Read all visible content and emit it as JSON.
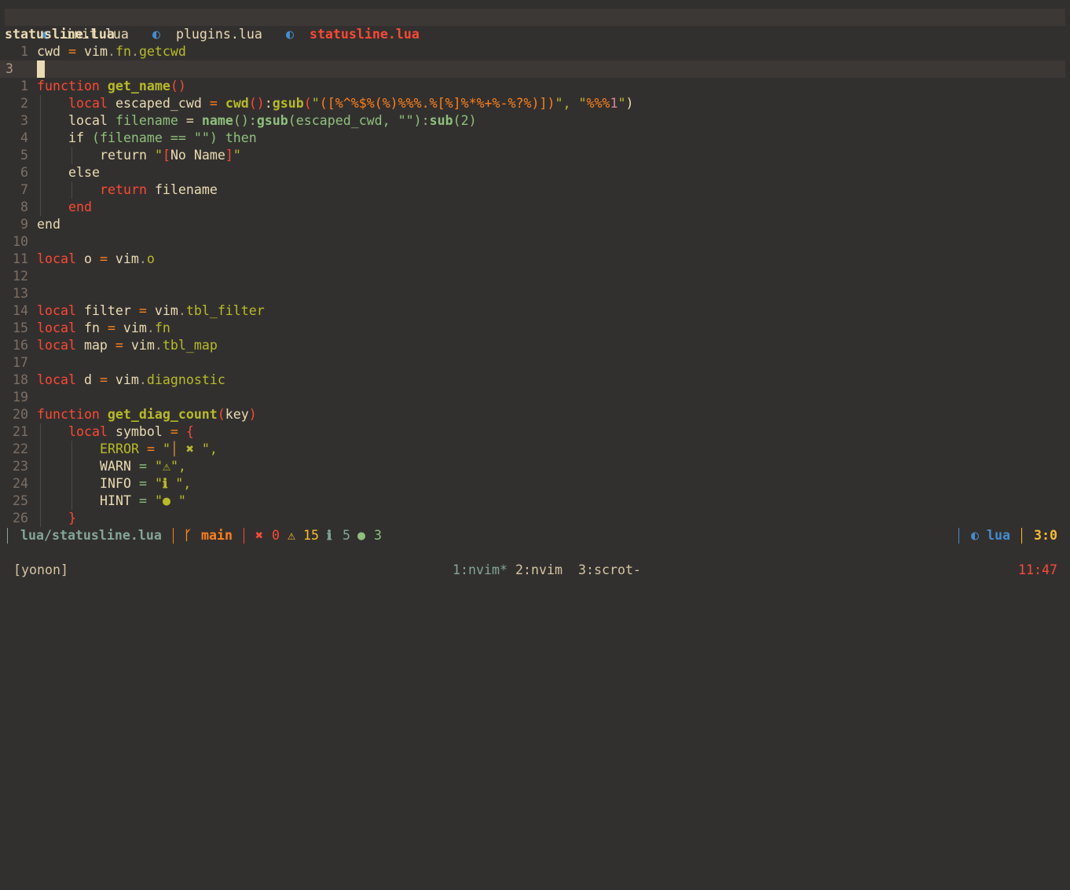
{
  "tabline": {
    "tabs": [
      {
        "icon": "lua-icon",
        "glyph": "◐",
        "label": "init.lua",
        "active": false
      },
      {
        "icon": "lua-icon",
        "glyph": "◐",
        "label": "plugins.lua",
        "active": false
      },
      {
        "icon": "lua-icon",
        "glyph": "◐",
        "label": "statusline.lua",
        "active": true
      }
    ]
  },
  "winbar": {
    "title": "statusline.lua"
  },
  "editor": {
    "lines": [
      {
        "nr": "1",
        "tokens": [
          [
            "fg",
            "cwd"
          ],
          [
            "op",
            " = "
          ],
          [
            "fg",
            "vim"
          ],
          [
            "dim",
            "."
          ],
          [
            "fld",
            "fn"
          ],
          [
            "dim",
            "."
          ],
          [
            "fld",
            "getcwd"
          ]
        ]
      },
      {
        "nr": "3",
        "current": true,
        "tokens": []
      },
      {
        "nr": "1",
        "tokens": [
          [
            "kw",
            "function "
          ],
          [
            "fn",
            "get_name"
          ],
          [
            "pu",
            "()"
          ]
        ]
      },
      {
        "nr": "2",
        "indent": 1,
        "tokens": [
          [
            "kw",
            "local "
          ],
          [
            "fg",
            "escaped_cwd "
          ],
          [
            "op",
            "= "
          ],
          [
            "fn",
            "cwd"
          ],
          [
            "pu",
            "()"
          ],
          [
            "fg",
            ":"
          ],
          [
            "fn",
            "gsub"
          ],
          [
            "pu",
            "("
          ],
          [
            "strg",
            "\""
          ],
          [
            "esc",
            "([%^%$%(%)%%%.%[%]%*%+%-%?%)])"
          ],
          [
            "strg",
            "\", \""
          ],
          [
            "esc",
            "%%%"
          ],
          [
            "num",
            "1"
          ],
          [
            "strg",
            "\""
          ],
          [
            "fg",
            ")"
          ]
        ]
      },
      {
        "nr": "3",
        "indent": 1,
        "tokens": [
          [
            "fg",
            "local "
          ],
          [
            "aq",
            "filename "
          ],
          [
            "fg",
            "= "
          ],
          [
            "aqb",
            "name"
          ],
          [
            "aq",
            "():"
          ],
          [
            "aqb",
            "gsub"
          ],
          [
            "aq",
            "(escaped_cwd, \"\"):"
          ],
          [
            "aqb",
            "sub"
          ],
          [
            "aq",
            "(2)"
          ]
        ]
      },
      {
        "nr": "4",
        "indent": 1,
        "tokens": [
          [
            "fg",
            "if "
          ],
          [
            "aq",
            "(filename == \"\") then"
          ]
        ]
      },
      {
        "nr": "5",
        "indent": 2,
        "tokens": [
          [
            "fg",
            "return "
          ],
          [
            "strg",
            "\""
          ],
          [
            "brk",
            "["
          ],
          [
            "fg",
            "No Name"
          ],
          [
            "brk",
            "]"
          ],
          [
            "strg",
            "\""
          ]
        ]
      },
      {
        "nr": "6",
        "indent": 1,
        "tokens": [
          [
            "fg",
            "else"
          ]
        ]
      },
      {
        "nr": "7",
        "indent": 2,
        "tokens": [
          [
            "kw",
            "return "
          ],
          [
            "fg",
            "filename"
          ]
        ]
      },
      {
        "nr": "8",
        "indent": 1,
        "tokens": [
          [
            "kw",
            "end"
          ]
        ]
      },
      {
        "nr": "9",
        "tokens": [
          [
            "fg",
            "end"
          ]
        ]
      },
      {
        "nr": "10",
        "tokens": []
      },
      {
        "nr": "11",
        "tokens": [
          [
            "kw",
            "local "
          ],
          [
            "fg",
            "o "
          ],
          [
            "op",
            "= "
          ],
          [
            "fg",
            "vim"
          ],
          [
            "dim",
            "."
          ],
          [
            "fld",
            "o"
          ]
        ]
      },
      {
        "nr": "12",
        "tokens": []
      },
      {
        "nr": "13",
        "tokens": []
      },
      {
        "nr": "14",
        "tokens": [
          [
            "kw",
            "local "
          ],
          [
            "fg",
            "filter "
          ],
          [
            "op",
            "= "
          ],
          [
            "fg",
            "vim"
          ],
          [
            "dim",
            "."
          ],
          [
            "fld",
            "tbl_filter"
          ]
        ]
      },
      {
        "nr": "15",
        "tokens": [
          [
            "kw",
            "local "
          ],
          [
            "fg",
            "fn "
          ],
          [
            "op",
            "= "
          ],
          [
            "fg",
            "vim"
          ],
          [
            "dim",
            "."
          ],
          [
            "fld",
            "fn"
          ]
        ]
      },
      {
        "nr": "16",
        "tokens": [
          [
            "kw",
            "local "
          ],
          [
            "fg",
            "map "
          ],
          [
            "op",
            "= "
          ],
          [
            "fg",
            "vim"
          ],
          [
            "dim",
            "."
          ],
          [
            "fld",
            "tbl_map"
          ]
        ]
      },
      {
        "nr": "17",
        "tokens": []
      },
      {
        "nr": "18",
        "tokens": [
          [
            "kw",
            "local "
          ],
          [
            "fg",
            "d "
          ],
          [
            "op",
            "= "
          ],
          [
            "fg",
            "vim"
          ],
          [
            "dim",
            "."
          ],
          [
            "fld",
            "diagnostic"
          ]
        ]
      },
      {
        "nr": "19",
        "tokens": []
      },
      {
        "nr": "20",
        "tokens": [
          [
            "kw",
            "function "
          ],
          [
            "fn",
            "get_diag_count"
          ],
          [
            "pu",
            "("
          ],
          [
            "fg",
            "key"
          ],
          [
            "pu",
            ")"
          ]
        ]
      },
      {
        "nr": "21",
        "indent": 1,
        "tokens": [
          [
            "kw",
            "local "
          ],
          [
            "fg",
            "symbol "
          ],
          [
            "op",
            "= "
          ],
          [
            "pu",
            "{"
          ]
        ]
      },
      {
        "nr": "22",
        "indent": 2,
        "tokens": [
          [
            "fld",
            "ERROR "
          ],
          [
            "op",
            "= "
          ],
          [
            "strg",
            "\""
          ],
          [
            "yel",
            "│ "
          ],
          [
            "ylw",
            "✖"
          ],
          [
            "strg",
            " \","
          ]
        ]
      },
      {
        "nr": "23",
        "indent": 2,
        "tokens": [
          [
            "fg",
            "WARN "
          ],
          [
            "aq",
            "= "
          ],
          [
            "strg",
            "\""
          ],
          [
            "ylw",
            "⚠"
          ],
          [
            "strg",
            "\","
          ]
        ]
      },
      {
        "nr": "24",
        "indent": 2,
        "tokens": [
          [
            "fg",
            "INFO "
          ],
          [
            "aq",
            "= "
          ],
          [
            "strg",
            "\""
          ],
          [
            "ylw",
            "ℹ"
          ],
          [
            "strg",
            " \","
          ]
        ]
      },
      {
        "nr": "25",
        "indent": 2,
        "tokens": [
          [
            "fg",
            "HINT "
          ],
          [
            "aq",
            "= "
          ],
          [
            "strg",
            "\""
          ],
          [
            "ylw",
            "●"
          ],
          [
            "strg",
            " \""
          ]
        ]
      },
      {
        "nr": "26",
        "indent": 1,
        "tokens": [
          [
            "pu",
            "}"
          ]
        ]
      }
    ]
  },
  "statusline": {
    "path": "lua/statusline.lua",
    "branch_icon": "git-branch-icon",
    "branch_glyph": "ᚴ",
    "branch": "main",
    "diagnostics": {
      "error_glyph": "✖",
      "error": "0",
      "warn_glyph": "⚠",
      "warn": "15",
      "info_glyph": "ℹ",
      "info": "5",
      "hint_glyph": "●",
      "hint": "3"
    },
    "filetype_glyph": "◐",
    "filetype": "lua",
    "position": "3:0",
    "colors": {
      "path": "#83a598",
      "branch": "#fe8019",
      "error": "#fb4934",
      "warn": "#fabd2f",
      "info": "#83a598",
      "hint": "#8ec07c",
      "filetype": "#458ccf",
      "position": "#fabd2f"
    }
  },
  "tmux": {
    "session": "[yonon]",
    "windows": [
      {
        "label": "1:nvim*",
        "active": true
      },
      {
        "label": "2:nvim",
        "active": false
      },
      {
        "label": "3:scrot-",
        "active": false
      }
    ],
    "clock": "11:47"
  }
}
